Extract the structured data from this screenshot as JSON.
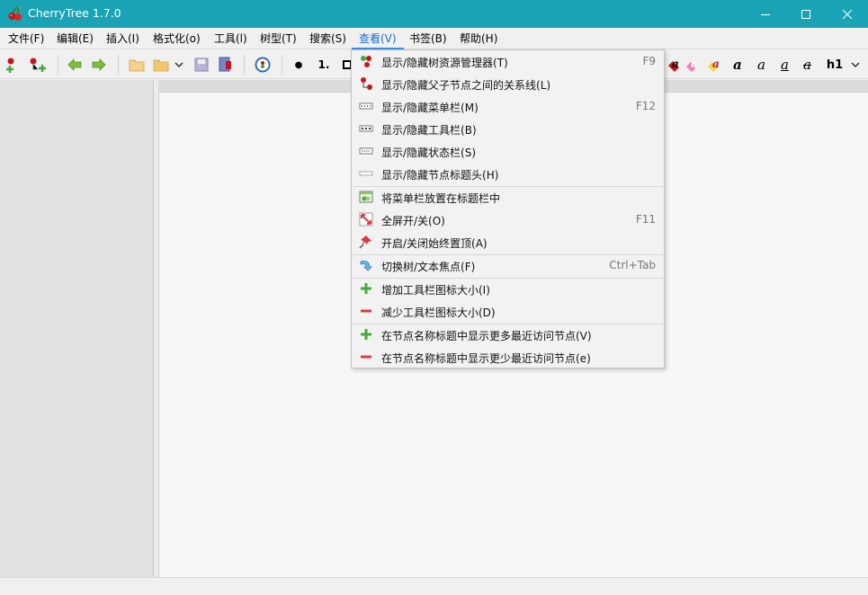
{
  "window": {
    "title": "CherryTree 1.7.0"
  },
  "menubar": {
    "items": [
      {
        "label": "文件(F)"
      },
      {
        "label": "编辑(E)"
      },
      {
        "label": "插入(I)"
      },
      {
        "label": "格式化(o)"
      },
      {
        "label": "工具(l)"
      },
      {
        "label": "树型(T)"
      },
      {
        "label": "搜索(S)"
      },
      {
        "label": "查看(V)",
        "active": true
      },
      {
        "label": "书签(B)"
      },
      {
        "label": "帮助(H)"
      }
    ]
  },
  "toolbar": {
    "list_bullet_label": "●",
    "list_number_label": "1.",
    "heading_label": "h1",
    "text_a_label": "a"
  },
  "view_menu": {
    "items": [
      {
        "label": "显示/隐藏树资源管理器(T)",
        "accel": "F9",
        "icon": "cherry-tree-icon"
      },
      {
        "label": "显示/隐藏父子节点之间的关系线(L)",
        "accel": "",
        "icon": "cherry-nodes-icon"
      },
      {
        "label": "显示/隐藏菜单栏(M)",
        "accel": "F12",
        "icon": "menubar-icon"
      },
      {
        "label": "显示/隐藏工具栏(B)",
        "accel": "",
        "icon": "toolbar-icon"
      },
      {
        "label": "显示/隐藏状态栏(S)",
        "accel": "",
        "icon": "statusbar-icon"
      },
      {
        "label": "显示/隐藏节点标题头(H)",
        "accel": "",
        "icon": "node-header-icon"
      },
      {
        "label": "将菜单栏放置在标题栏中",
        "accel": "",
        "icon": "menu-in-titlebar-icon"
      },
      {
        "label": "全屏开/关(O)",
        "accel": "F11",
        "icon": "fullscreen-icon"
      },
      {
        "label": "开启/关闭始终置顶(A)",
        "accel": "",
        "icon": "pin-icon"
      },
      {
        "label": "切换树/文本焦点(F)",
        "accel": "Ctrl+Tab",
        "icon": "toggle-focus-icon"
      },
      {
        "label": "增加工具栏图标大小(I)",
        "accel": "",
        "icon": "plus-icon"
      },
      {
        "label": "减少工具栏图标大小(D)",
        "accel": "",
        "icon": "minus-icon"
      },
      {
        "label": "在节点名称标题中显示更多最近访问节点(V)",
        "accel": "",
        "icon": "plus-icon"
      },
      {
        "label": "在节点名称标题中显示更少最近访问节点(e)",
        "accel": "",
        "icon": "minus-icon"
      }
    ]
  },
  "colors": {
    "titlebar": "#1aa3b5",
    "accent": "#3a8ee6",
    "plus": "#47a93a",
    "minus": "#d93a4a"
  }
}
